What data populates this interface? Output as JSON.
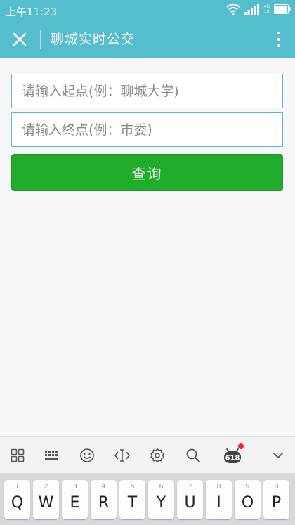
{
  "status_bar": {
    "time": "上午11:23",
    "network_top": "4G",
    "network_bottom": "1X",
    "icons": [
      "wifi-icon",
      "signal-icon",
      "battery-icon"
    ]
  },
  "app_bar": {
    "title": "聊城实时公交",
    "close_icon": "close-icon",
    "more_icon": "more-vertical-icon",
    "background": "#55bdcc"
  },
  "form": {
    "start_placeholder": "请输入起点(例：聊城大学)",
    "end_placeholder": "请输入终点(例：市委)",
    "start_value": "",
    "end_value": "",
    "query_label": "查询",
    "query_color": "#1fac2a",
    "field_border_color": "#55bdcc"
  },
  "keyboard": {
    "toolbar": [
      "grid-icon",
      "keyboard-icon",
      "emoji-icon",
      "cursor-icon",
      "gear-icon",
      "search-icon",
      "promo-618-icon",
      "chevron-down-icon"
    ],
    "promo_label": "618",
    "keys": [
      {
        "num": "1",
        "letter": "Q"
      },
      {
        "num": "2",
        "letter": "W"
      },
      {
        "num": "3",
        "letter": "E"
      },
      {
        "num": "4",
        "letter": "R"
      },
      {
        "num": "5",
        "letter": "T"
      },
      {
        "num": "6",
        "letter": "Y"
      },
      {
        "num": "7",
        "letter": "U"
      },
      {
        "num": "8",
        "letter": "I"
      },
      {
        "num": "9",
        "letter": "O"
      },
      {
        "num": "0",
        "letter": "P"
      }
    ]
  }
}
